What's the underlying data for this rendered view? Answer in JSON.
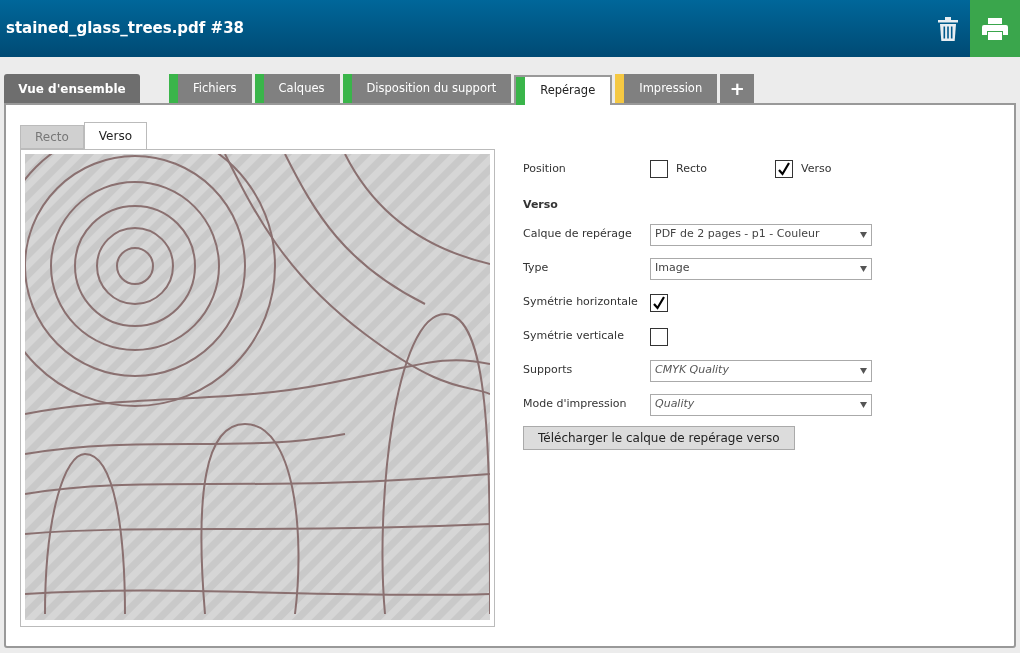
{
  "window": {
    "title": "stained_glass_trees.pdf #38"
  },
  "overview_tab": {
    "label": "Vue d'ensemble"
  },
  "tabs": [
    {
      "label": "Fichiers",
      "selected": false,
      "color": "#3ab54a"
    },
    {
      "label": "Calques",
      "selected": false,
      "color": "#3ab54a"
    },
    {
      "label": "Disposition du support",
      "selected": false,
      "color": "#3ab54a"
    },
    {
      "label": "Repérage",
      "selected": true,
      "color": "#3ab54a"
    },
    {
      "label": "Impression",
      "selected": false,
      "color": "#f5c842"
    }
  ],
  "add_tab": {
    "label": "+"
  },
  "side_tabs": [
    {
      "label": "Recto",
      "selected": false
    },
    {
      "label": "Verso",
      "selected": true
    }
  ],
  "position": {
    "label": "Position",
    "options": [
      {
        "label": "Recto",
        "checked": false
      },
      {
        "label": "Verso",
        "checked": true
      }
    ]
  },
  "section": {
    "title": "Verso"
  },
  "fields": [
    {
      "kind": "select",
      "label": "Calque de repérage",
      "value": "PDF de 2 pages - p1 - Couleur",
      "italic": false
    },
    {
      "kind": "select",
      "label": "Type",
      "value": "Image",
      "italic": false
    },
    {
      "kind": "checkbox",
      "label": "Symétrie horizontale",
      "checked": true
    },
    {
      "kind": "checkbox",
      "label": "Symétrie verticale",
      "checked": false
    },
    {
      "kind": "select",
      "label": "Supports",
      "value": "CMYK Quality",
      "italic": true
    },
    {
      "kind": "select",
      "label": "Mode d'impression",
      "value": "Quality",
      "italic": true
    }
  ],
  "download_button": {
    "label": "Télécharger le calque de repérage verso"
  }
}
